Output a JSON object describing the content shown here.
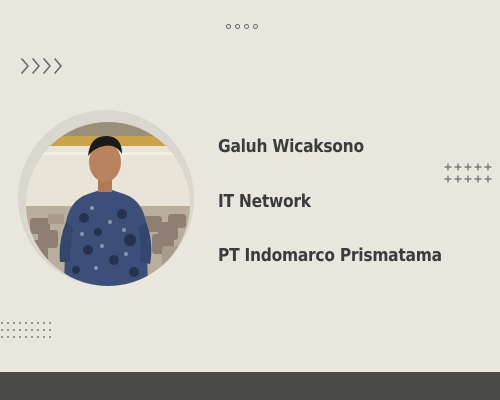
{
  "profile": {
    "name": "Galuh Wicaksono",
    "role": "IT Network",
    "company": "PT Indomarco Prismatama"
  },
  "icons": {
    "top": "four-dots-icon",
    "chevrons": "chevron-right-icon",
    "plus_grid": "plus-grid-icon",
    "dot_grid": "dot-grid-icon"
  },
  "colors": {
    "background": "#e8e6dd",
    "text": "#3c3c3c",
    "decoration": "#6a6a6a",
    "footer": "#4a4a48"
  }
}
